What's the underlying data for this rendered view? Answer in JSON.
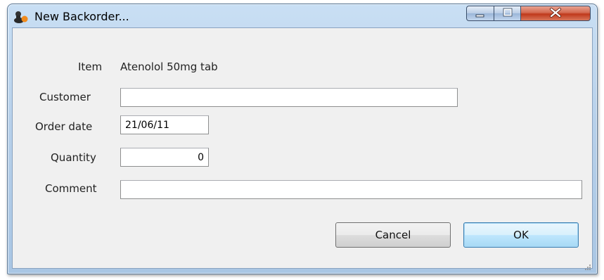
{
  "window": {
    "title": "New Backorder..."
  },
  "form": {
    "item_label": "Item",
    "item_value": "Atenolol 50mg tab",
    "customer_label": "Customer",
    "customer_value": "",
    "order_date_label": "Order date",
    "order_date_value": "21/06/11",
    "quantity_label": "Quantity",
    "quantity_value": "0",
    "comment_label": "Comment",
    "comment_value": ""
  },
  "buttons": {
    "cancel_label": "Cancel",
    "ok_label": "OK"
  },
  "icons": {
    "app": "app-icon",
    "minimize": "minimize-icon",
    "maximize": "maximize-icon",
    "close": "close-icon",
    "resize": "resize-grip-icon"
  },
  "colors": {
    "titlebar": "#b7d0ea",
    "client_bg": "#f0f0f0",
    "close_button": "#c0391b",
    "default_button_border": "#3c7fb1"
  }
}
